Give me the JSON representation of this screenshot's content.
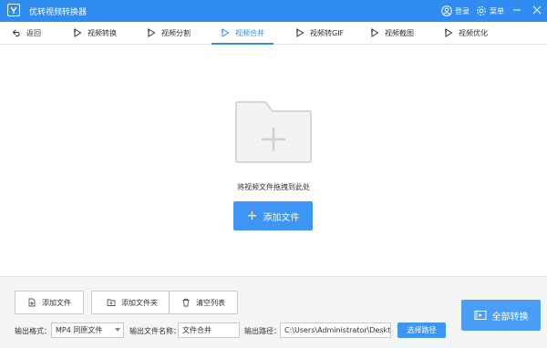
{
  "app": {
    "title": "优转视频转换器"
  },
  "header": {
    "login_label": "登录",
    "menu_label": "菜单"
  },
  "tabs": [
    {
      "label": "返回",
      "icon": "back-icon"
    },
    {
      "label": "视频转换",
      "icon": "play-icon"
    },
    {
      "label": "视频分割",
      "icon": "play-icon"
    },
    {
      "label": "视频合并",
      "icon": "play-icon",
      "active": true
    },
    {
      "label": "视频转GIF",
      "icon": "play-icon"
    },
    {
      "label": "视频截图",
      "icon": "play-icon"
    },
    {
      "label": "视频优化",
      "icon": "play-icon"
    }
  ],
  "dropzone": {
    "hint": "将视频文件拖拽到此处",
    "add_button": "添加文件"
  },
  "actions": {
    "add_file": "添加文件",
    "add_folder": "添加文件夹",
    "clear_list": "清空列表",
    "convert_all": "全部转换"
  },
  "settings": {
    "format_label": "输出格式：",
    "format_value": "MP4  同原文件",
    "filename_label": "输出文件名称：",
    "filename_value": "文件合并",
    "path_label": "输出路径：",
    "path_value": "C:\\Users\\Administrator\\Desktop",
    "choose_path": "选择路径"
  },
  "colors": {
    "accent": "#2f8cf0",
    "button": "#3d95f5",
    "panel": "#f5f5f5"
  }
}
